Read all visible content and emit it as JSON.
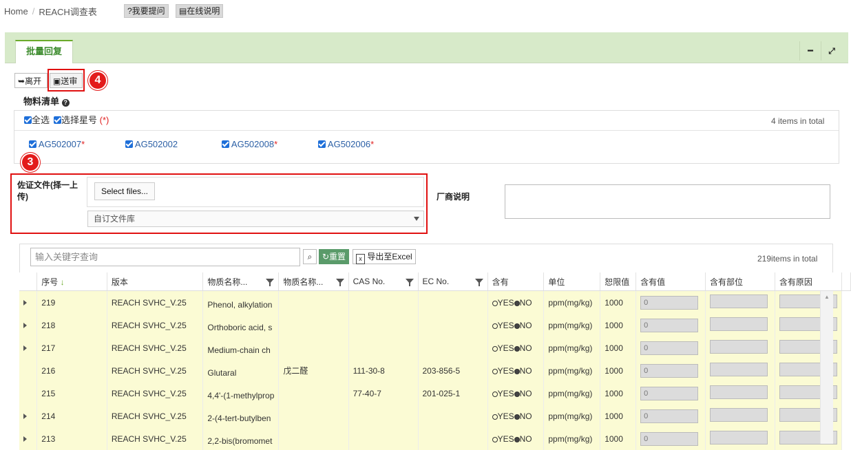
{
  "breadcrumb": {
    "home": "Home",
    "separator": "/",
    "current": "REACH调查表"
  },
  "header_buttons": {
    "ask": "?我要提问",
    "help": "在线说明"
  },
  "panel": {
    "tab": "批量回复",
    "minimize": "━",
    "maximize": "⤢"
  },
  "toolbar": {
    "leave": "离开",
    "submit": "送审"
  },
  "badges": {
    "submit_step": "4",
    "file_step": "3"
  },
  "materials": {
    "title": "物料清单",
    "select_all": "全选",
    "select_star": "选择星号",
    "star_paren": "(*)",
    "total_count": "4",
    "total_suffix": "items in total",
    "items": [
      {
        "code": "AG502007",
        "star": "*"
      },
      {
        "code": "AG502002",
        "star": ""
      },
      {
        "code": "AG502008",
        "star": "*"
      },
      {
        "code": "AG502006",
        "star": "*"
      }
    ]
  },
  "evidence": {
    "label": "佐证文件(择一上传)",
    "select_files": "Select files...",
    "library": "自订文件库"
  },
  "vendor_note": {
    "label": "厂商说明"
  },
  "grid": {
    "search_placeholder": "输入关键字查询",
    "reset": "重置",
    "export": "导出至Excel",
    "total_count": "219",
    "total_suffix": "items in total",
    "columns": [
      "序号",
      "版本",
      "物质名称...",
      "物质名称...",
      "CAS No.",
      "EC No.",
      "含有",
      "单位",
      "恕限值",
      "含有值",
      "含有部位",
      "含有原因"
    ],
    "yes": "YES",
    "no": "NO",
    "rows": [
      {
        "expand": true,
        "no": "219",
        "version": "REACH SVHC_V.25",
        "name": "Phenol, alkylation",
        "name_cn": "",
        "cas": "",
        "ec": "",
        "unit": "ppm(mg/kg)",
        "threshold": "1000",
        "value": "0"
      },
      {
        "expand": true,
        "no": "218",
        "version": "REACH SVHC_V.25",
        "name": "Orthoboric acid, s",
        "name_cn": "",
        "cas": "",
        "ec": "",
        "unit": "ppm(mg/kg)",
        "threshold": "1000",
        "value": "0"
      },
      {
        "expand": true,
        "no": "217",
        "version": "REACH SVHC_V.25",
        "name": "Medium-chain ch",
        "name_cn": "",
        "cas": "",
        "ec": "",
        "unit": "ppm(mg/kg)",
        "threshold": "1000",
        "value": "0"
      },
      {
        "expand": false,
        "no": "216",
        "version": "REACH SVHC_V.25",
        "name": "Glutaral",
        "name_cn": "戊二醛",
        "cas": "111-30-8",
        "ec": "203-856-5",
        "unit": "ppm(mg/kg)",
        "threshold": "1000",
        "value": "0"
      },
      {
        "expand": false,
        "no": "215",
        "version": "REACH SVHC_V.25",
        "name": "4,4'-(1-methylprop",
        "name_cn": "",
        "cas": "77-40-7",
        "ec": "201-025-1",
        "unit": "ppm(mg/kg)",
        "threshold": "1000",
        "value": "0"
      },
      {
        "expand": true,
        "no": "214",
        "version": "REACH SVHC_V.25",
        "name": "2-(4-tert-butylben",
        "name_cn": "",
        "cas": "",
        "ec": "",
        "unit": "ppm(mg/kg)",
        "threshold": "1000",
        "value": "0"
      },
      {
        "expand": true,
        "no": "213",
        "version": "REACH SVHC_V.25",
        "name": "2,2-bis(bromomet",
        "name_cn": "",
        "cas": "",
        "ec": "",
        "unit": "ppm(mg/kg)",
        "threshold": "1000",
        "value": "0"
      }
    ]
  }
}
